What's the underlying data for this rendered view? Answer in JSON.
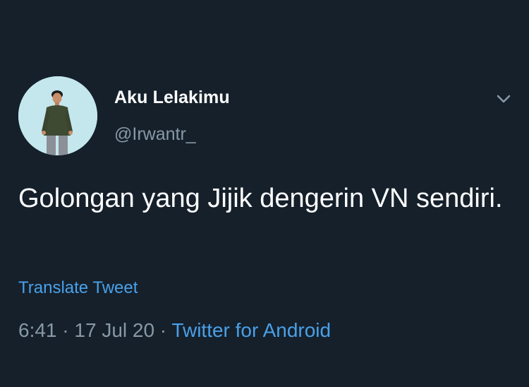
{
  "tweet": {
    "display_name": "Aku Lelakimu",
    "handle": "@Irwantr_",
    "text": "Golongan yang Jijik dengerin VN sendiri.",
    "translate_label": "Translate Tweet",
    "time": "6:41",
    "separator_1": " · ",
    "date": "17 Jul 20",
    "separator_2": " · ",
    "source": "Twitter for Android"
  },
  "icons": {
    "avatar": "profile-photo",
    "menu": "chevron-down-icon"
  },
  "colors": {
    "background": "#15202b",
    "primary_text": "#ffffff",
    "secondary_text": "#8899a6",
    "link": "#4aa0e8"
  }
}
